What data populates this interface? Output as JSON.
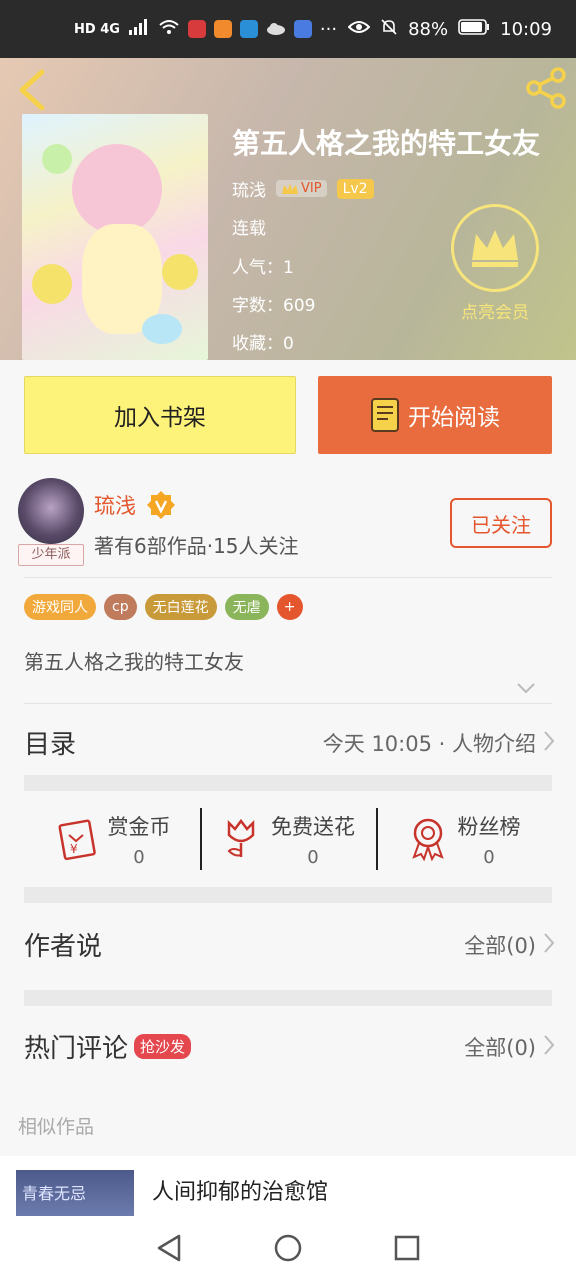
{
  "status_bar": {
    "left_text": "HD 4G",
    "battery": "88%",
    "time": "10:09"
  },
  "book": {
    "title": "第五人格之我的特工女友",
    "author": "琉浅",
    "vip_label": "VIP",
    "level": "Lv2",
    "status": "连载",
    "popularity": "人气：1",
    "word_count": "字数：609",
    "favorites": "收藏：0",
    "member_label": "点亮会员"
  },
  "actions": {
    "add_shelf": "加入书架",
    "start_read": "开始阅读"
  },
  "author_card": {
    "name": "琉浅",
    "tag": "少年派",
    "info": "著有6部作品·15人关注",
    "follow_label": "已关注"
  },
  "tags": [
    {
      "label": "游戏同人",
      "color": "#f2a93b"
    },
    {
      "label": "cp",
      "color": "#c07a5c"
    },
    {
      "label": "无白莲花",
      "color": "#c99a3a"
    },
    {
      "label": "无虐",
      "color": "#8bb55a"
    },
    {
      "label": "+",
      "color": "#e4572e"
    }
  ],
  "description": "第五人格之我的特工女友",
  "catalog": {
    "title": "目录",
    "latest": "今天 10:05 · 人物介绍"
  },
  "stats": [
    {
      "label": "赏金币",
      "value": "0",
      "icon": "red-envelope-icon"
    },
    {
      "label": "免费送花",
      "value": "0",
      "icon": "flower-icon"
    },
    {
      "label": "粉丝榜",
      "value": "0",
      "icon": "medal-icon"
    }
  ],
  "author_says": {
    "title": "作者说",
    "all": "全部(0)"
  },
  "hot_comments": {
    "title": "热门评论",
    "badge": "抢沙发",
    "all": "全部(0)"
  },
  "similar": {
    "title": "相似作品",
    "item_title": "人间抑郁的治愈馆",
    "cover_text": "青春无忌"
  },
  "colors": {
    "accent": "#e96c3f",
    "shelf": "#fdf27a",
    "author": "#e4572e",
    "member": "#f7e57c"
  }
}
